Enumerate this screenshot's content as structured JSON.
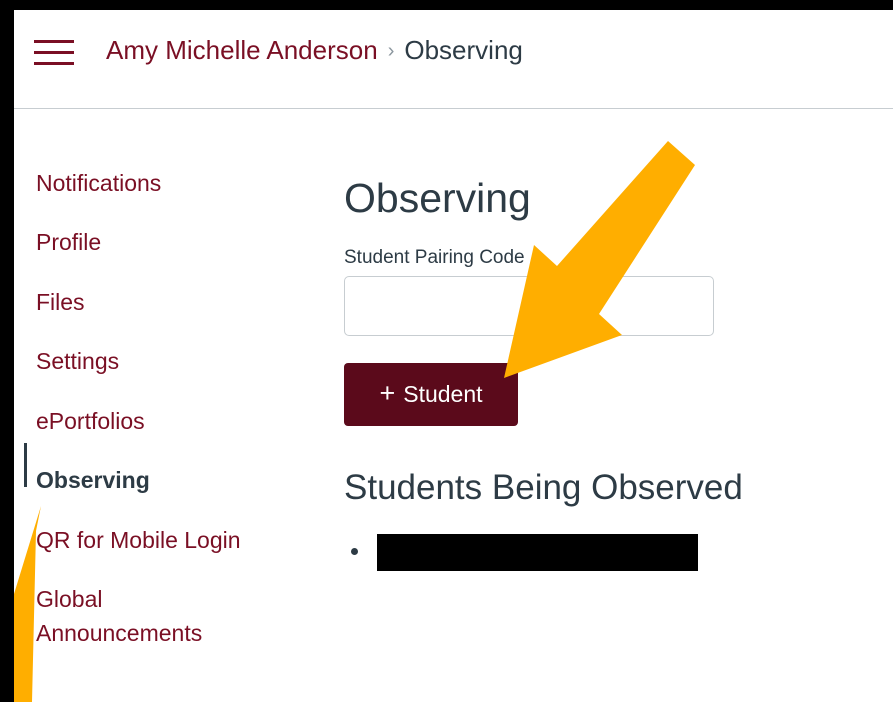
{
  "header": {
    "menu_icon": "hamburger-icon",
    "breadcrumb": {
      "user": "Amy Michelle Anderson",
      "separator": "›",
      "current": "Observing"
    }
  },
  "sidebar": {
    "items": [
      {
        "label": "Notifications"
      },
      {
        "label": "Profile"
      },
      {
        "label": "Files"
      },
      {
        "label": "Settings"
      },
      {
        "label": "ePortfolios"
      },
      {
        "label": "Observing",
        "active": true
      },
      {
        "label": "QR for Mobile Login"
      },
      {
        "label": "Global"
      },
      {
        "label": "Announcements"
      }
    ]
  },
  "main": {
    "title": "Observing",
    "pairing_label": "Student Pairing Code",
    "pairing_value": "",
    "add_button": {
      "icon": "plus-icon",
      "plus": "+",
      "label": "Student"
    },
    "observed_title": "Students Being Observed",
    "observed_students": [
      {
        "redacted": true
      }
    ]
  },
  "annotations": {
    "arrow_color": "#ffae00",
    "count": 2
  },
  "colors": {
    "brand": "#7a0f24",
    "button": "#5b0a1b",
    "text": "#2d3b45",
    "border": "#c7cdd1"
  }
}
